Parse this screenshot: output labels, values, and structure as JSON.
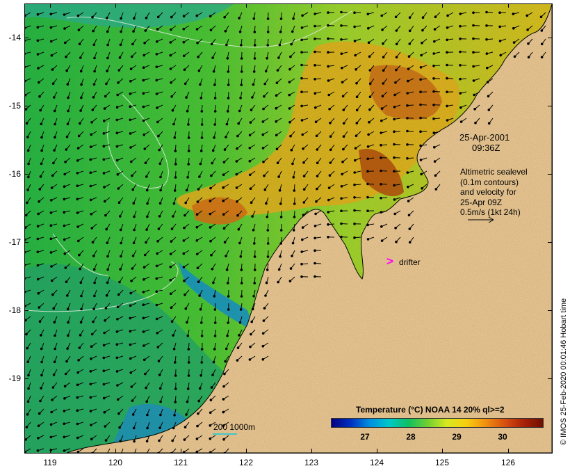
{
  "axes": {
    "y_ticks": [
      "-14",
      "-15",
      "-16",
      "-17",
      "-18",
      "-19"
    ],
    "x_ticks": [
      "119",
      "120",
      "121",
      "122",
      "123",
      "124",
      "125",
      "126"
    ]
  },
  "annotation": {
    "date": "25-Apr-2001",
    "time": "09:36Z",
    "legend_lines": [
      "Altimetric sealevel",
      "(0.1m contours)",
      "and velocity for",
      "25-Apr 09Z",
      "0.5m/s (1kt 24h)"
    ]
  },
  "drifter": {
    "marker": ">",
    "label": "drifter"
  },
  "depth_scale": {
    "label": "200  1000m",
    "color": "#40c8c8"
  },
  "colorbar": {
    "title": "Temperature (°C) NOAA 14 20% ql>=2",
    "ticks": [
      "27",
      "28",
      "29",
      "30"
    ],
    "colors": [
      "#000080",
      "#0090e0",
      "#10c060",
      "#d8e820",
      "#f09010",
      "#a82008",
      "#701000"
    ]
  },
  "copyright": "© IMOS 25-Feb-2020 00:01:46 Hobart time",
  "land_color": "#f9c99b"
}
